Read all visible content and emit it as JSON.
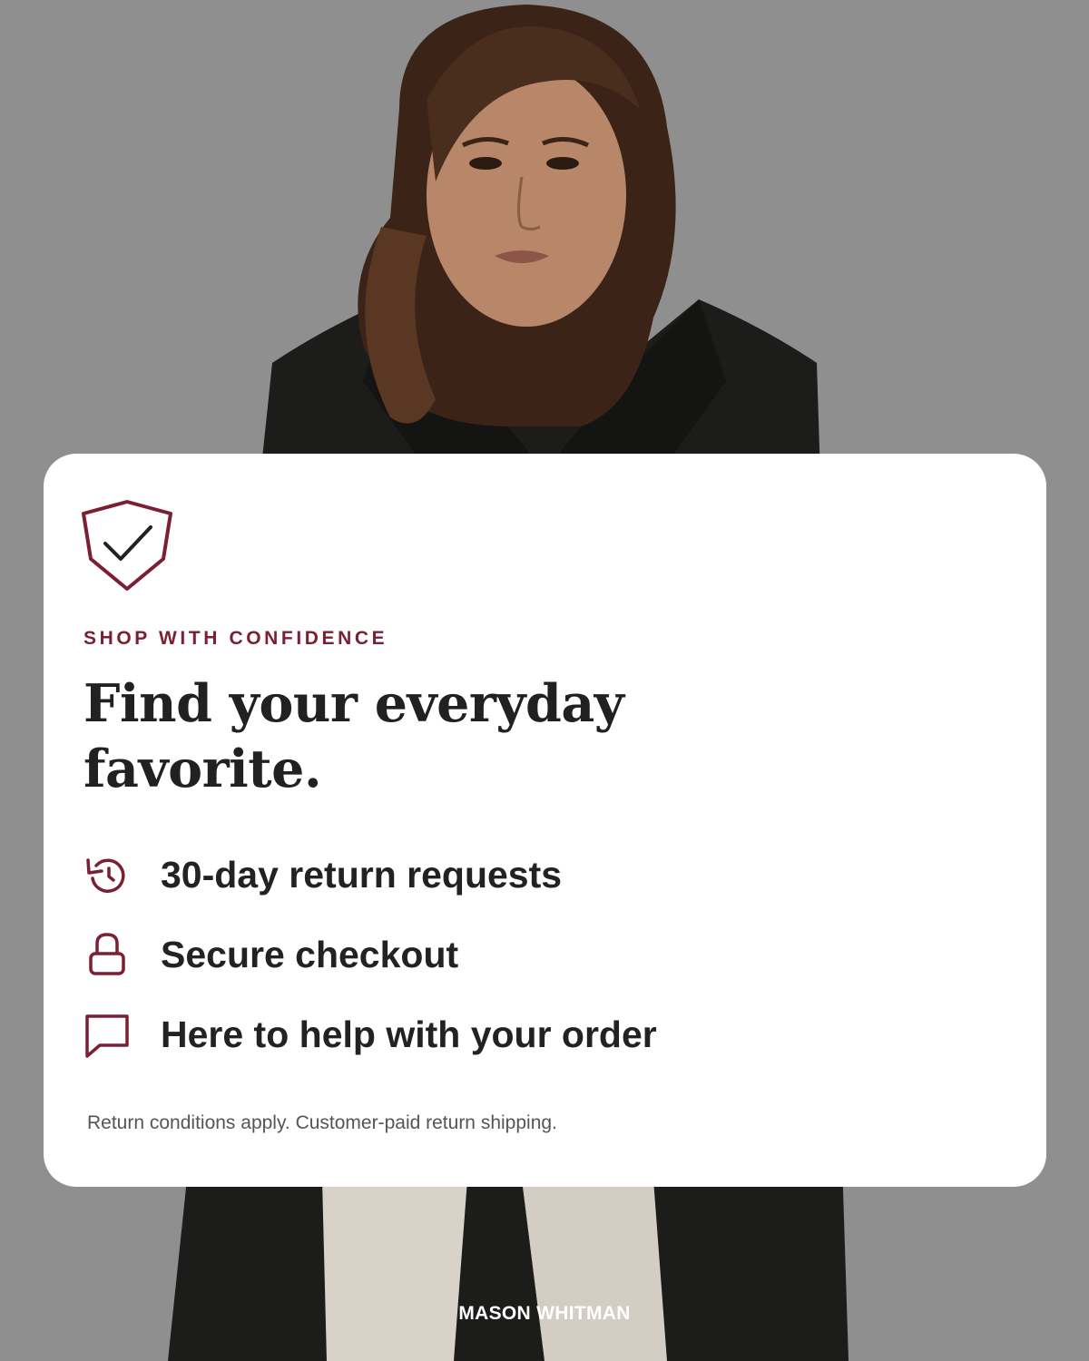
{
  "brand": {
    "name": "MASON WHITMAN"
  },
  "hero": {
    "image": "woman-in-black-coat-photo"
  },
  "card": {
    "badge_icon": "shield-check-icon",
    "eyebrow": "SHOP WITH CONFIDENCE",
    "headline": "Find your everyday favorite.",
    "features": [
      {
        "icon": "return-arrow-icon",
        "label": "30-day return requests"
      },
      {
        "icon": "lock-icon",
        "label": "Secure checkout"
      },
      {
        "icon": "chat-bubble-icon",
        "label": "Here to help with your order"
      }
    ],
    "footnote": "Return conditions apply. Customer-paid return shipping."
  },
  "colors": {
    "accent": "#7a1f34",
    "text": "#222222",
    "card": "#ffffff",
    "backdrop": "#8f8f8f"
  }
}
